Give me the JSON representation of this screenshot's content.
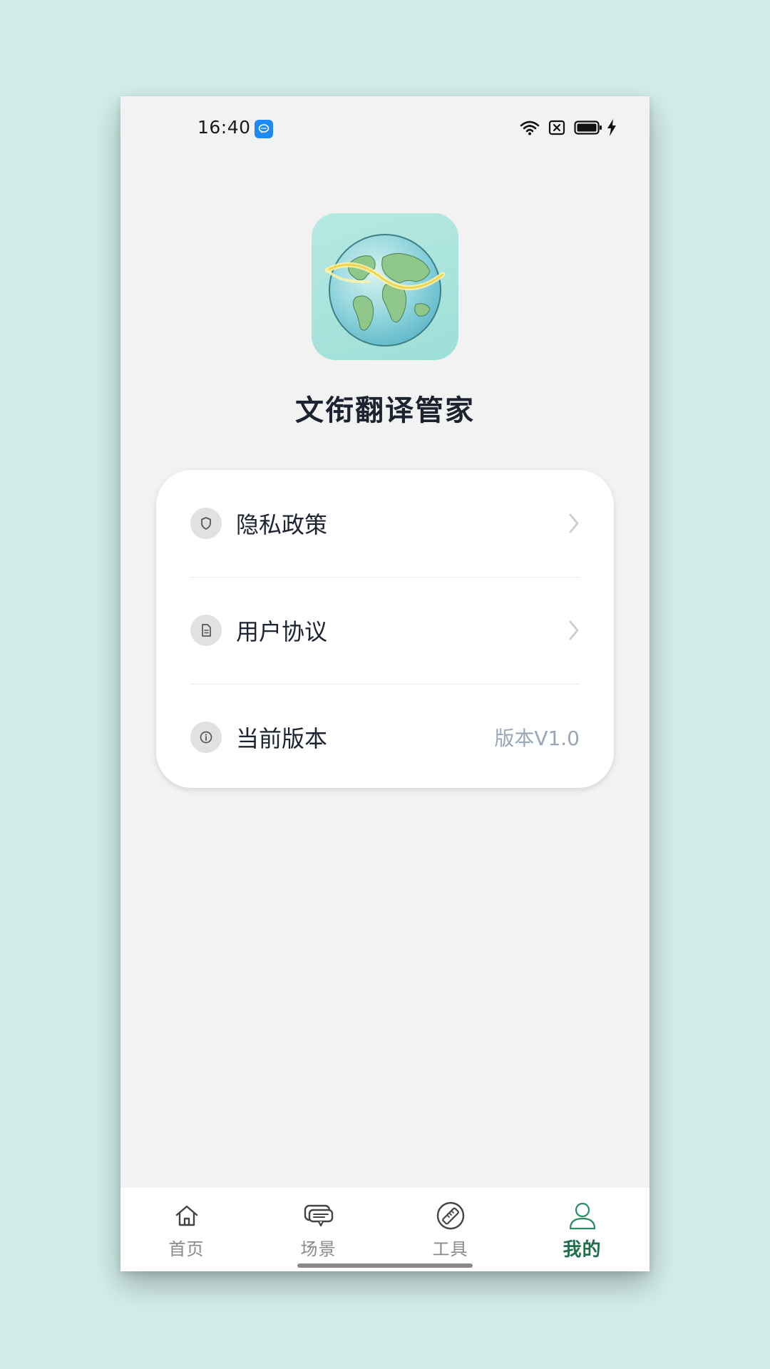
{
  "status_bar": {
    "time": "16:40",
    "notification_icon": "chat-bubble-icon",
    "icons": [
      "wifi-icon",
      "sim-blocked-icon",
      "battery-icon",
      "charging-bolt-icon"
    ]
  },
  "app": {
    "logo_icon": "globe-icon",
    "name": "文衔翻译管家"
  },
  "menu": {
    "items": [
      {
        "label": "隐私政策",
        "icon": "shield-icon",
        "trailing": "chevron-right-icon"
      },
      {
        "label": "用户协议",
        "icon": "document-icon",
        "trailing": "chevron-right-icon"
      },
      {
        "label": "当前版本",
        "icon": "info-icon",
        "value": "版本V1.0"
      }
    ]
  },
  "tabbar": {
    "tabs": [
      {
        "label": "首页",
        "icon": "home-icon",
        "active": false
      },
      {
        "label": "场景",
        "icon": "chat-icon",
        "active": false
      },
      {
        "label": "工具",
        "icon": "ruler-icon",
        "active": false
      },
      {
        "label": "我的",
        "icon": "user-icon",
        "active": true
      }
    ]
  },
  "colors": {
    "background": "#d3ede9",
    "page": "#f2f2f2",
    "accent": "#1f6e4c",
    "text_primary": "#1d2330",
    "text_muted": "#9aa6b6"
  }
}
